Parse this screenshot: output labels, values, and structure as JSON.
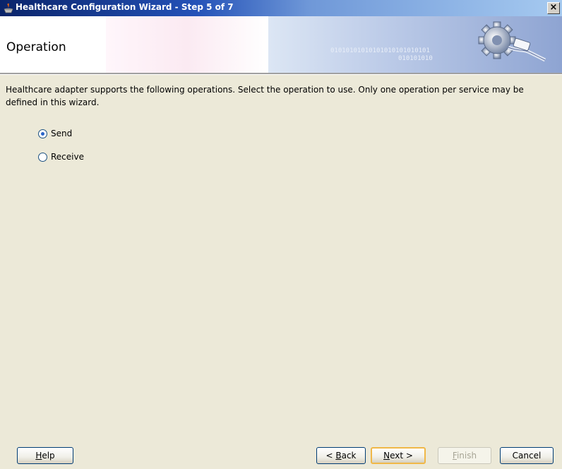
{
  "window": {
    "title": "Healthcare Configuration Wizard - Step 5 of 7",
    "close_glyph": "×"
  },
  "banner": {
    "title": "Operation",
    "bits_line1": "01010101010101010101010101",
    "bits_line2": "010101010"
  },
  "description": "Healthcare adapter supports the following operations.  Select the operation to use.  Only one operation per service may be defined in this wizard.",
  "operations": {
    "selected": "Send",
    "options": [
      {
        "label": "Send",
        "checked": true
      },
      {
        "label": "Receive",
        "checked": false
      }
    ]
  },
  "buttons": {
    "help": {
      "mnemonic": "H",
      "rest": "elp"
    },
    "back": {
      "prefix": "< ",
      "mnemonic": "B",
      "rest": "ack"
    },
    "next": {
      "mnemonic": "N",
      "rest": "ext >"
    },
    "finish": {
      "mnemonic": "F",
      "rest": "inish",
      "enabled": false
    },
    "cancel": {
      "label": "Cancel"
    }
  },
  "colors": {
    "title_bar_start": "#0a246a",
    "title_bar_end": "#a6caf0",
    "dialog_bg": "#ece9d8",
    "default_button_border": "#f0b848"
  },
  "icons": {
    "title": "oracle-cup-icon",
    "banner": "gear-plug-icon"
  }
}
